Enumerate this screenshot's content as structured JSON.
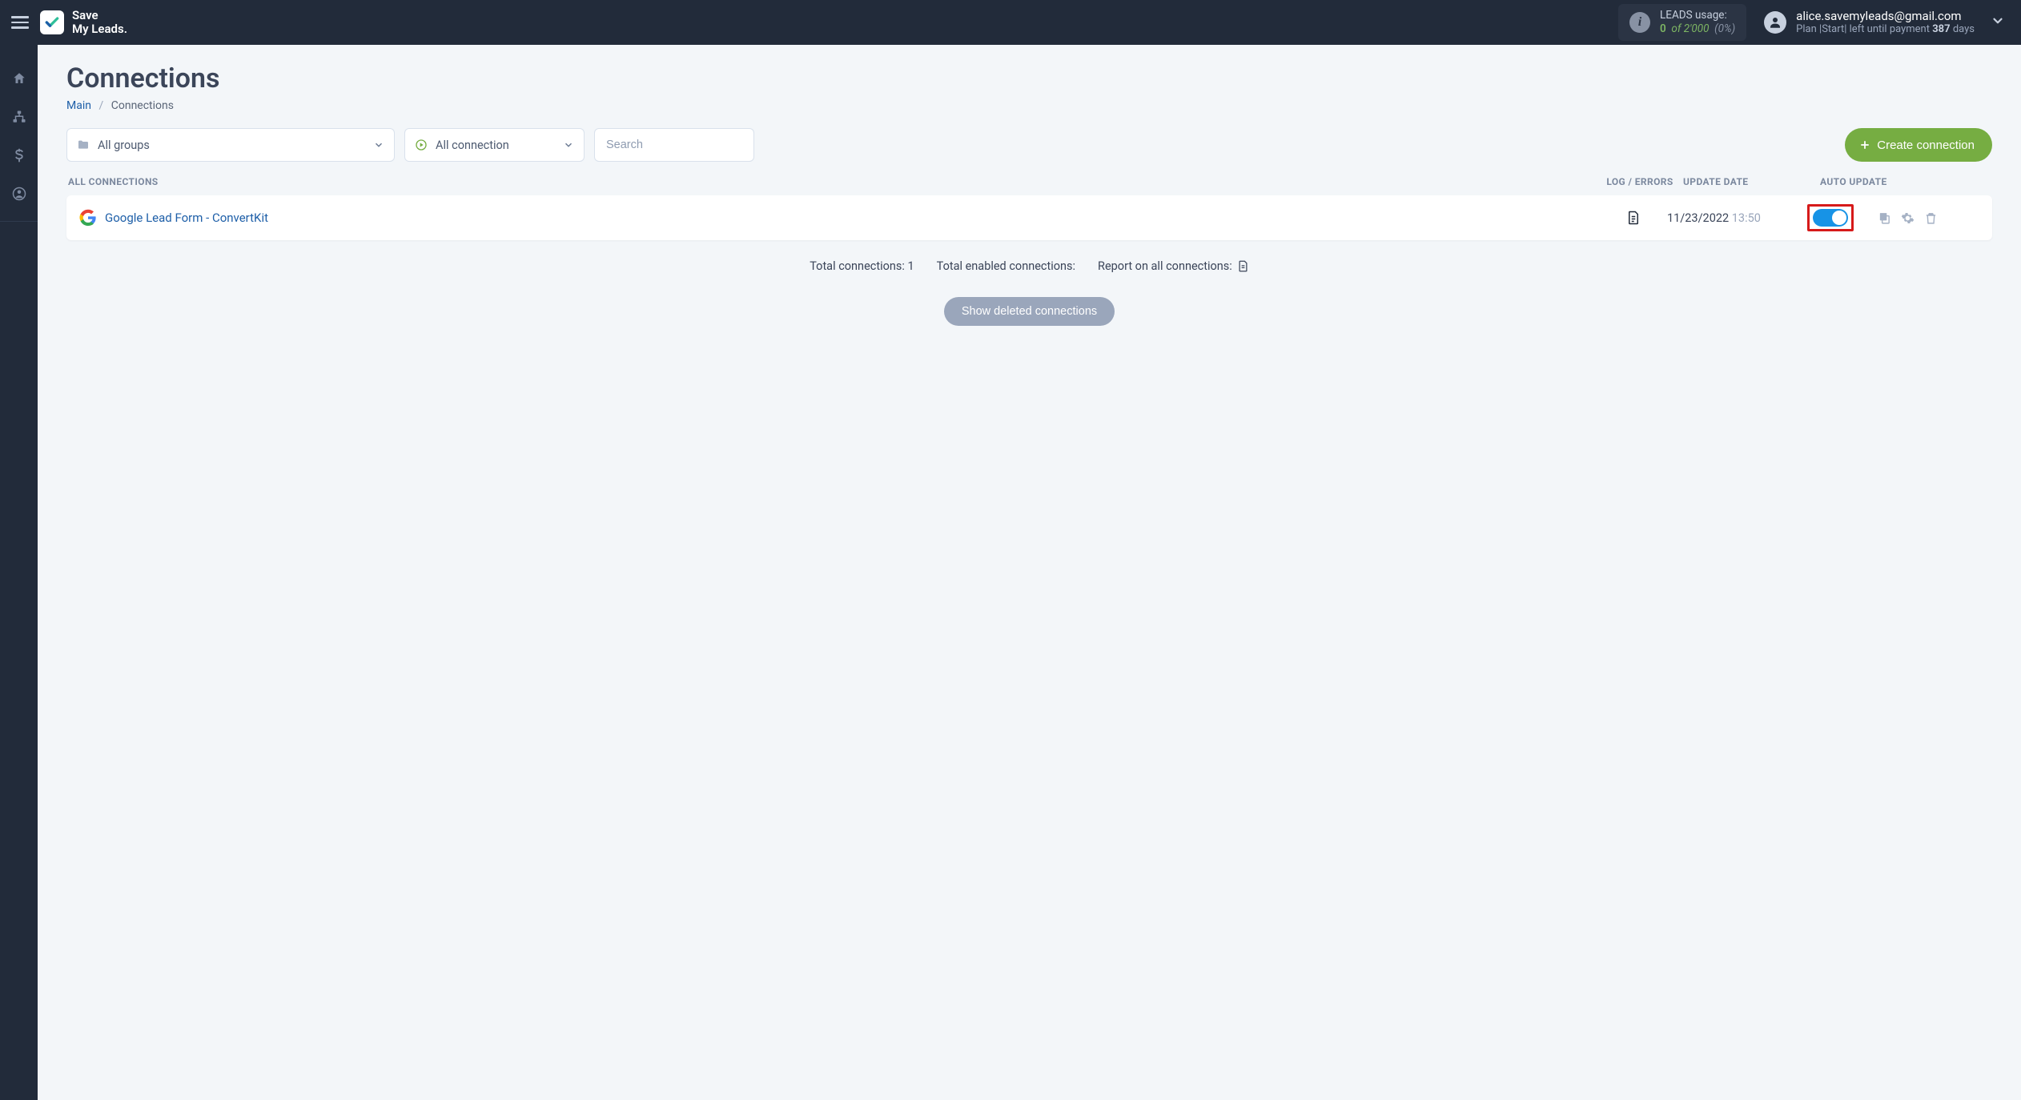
{
  "brand": {
    "line1": "Save",
    "line2": "My Leads."
  },
  "leads": {
    "title": "LEADS usage:",
    "current": "0",
    "of_word": "of",
    "limit": "2'000",
    "pct": "(0%)"
  },
  "user": {
    "email": "alice.savemyleads@gmail.com",
    "plan_prefix": "Plan ",
    "plan_name": "|Start|",
    "left_prefix": " left until payment ",
    "days_num": "387",
    "days_suffix": " days"
  },
  "page": {
    "title": "Connections",
    "crumb_main": "Main",
    "crumb_sep": "/",
    "crumb_current": "Connections"
  },
  "filters": {
    "groups": "All groups",
    "connection": "All connection",
    "search_placeholder": "Search",
    "create_btn": "Create connection"
  },
  "list_header": {
    "name": "ALL CONNECTIONS",
    "log": "LOG / ERRORS",
    "update": "UPDATE DATE",
    "auto": "AUTO UPDATE"
  },
  "rows": [
    {
      "title": "Google Lead Form - ConvertKit",
      "date": "11/23/2022",
      "time": "13:50",
      "auto_on": true
    }
  ],
  "stats": {
    "total": "Total connections: 1",
    "enabled": "Total enabled connections:",
    "report": "Report on all connections:"
  },
  "deleted_btn": "Show deleted connections"
}
